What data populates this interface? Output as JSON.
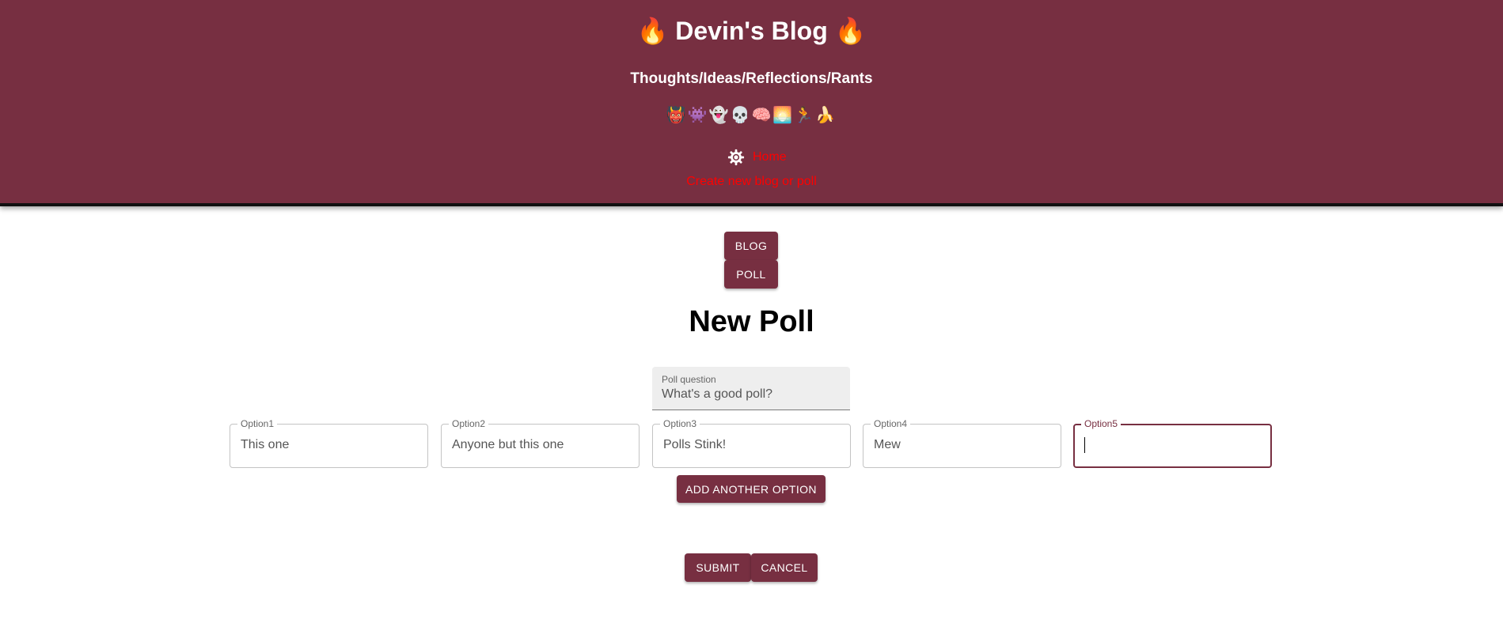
{
  "header": {
    "title": "🔥 Devin's Blog 🔥",
    "tagline": "Thoughts/Ideas/Reflections/Rants",
    "emojis": "👹👾👻💀🧠🌅🏃🍌",
    "home_label": "Home",
    "create_label": "Create new blog or poll"
  },
  "toggle": {
    "blog_label": "BLOG",
    "poll_label": "POLL"
  },
  "main": {
    "title": "New Poll",
    "question": {
      "label": "Poll question",
      "value": "What's a good poll?"
    },
    "options": [
      {
        "label": "Option1",
        "value": "This one"
      },
      {
        "label": "Option2",
        "value": "Anyone but this one"
      },
      {
        "label": "Option3",
        "value": "Polls Stink!"
      },
      {
        "label": "Option4",
        "value": "Mew"
      },
      {
        "label": "Option5",
        "value": ""
      }
    ],
    "add_option_label": "ADD ANOTHER OPTION",
    "submit_label": "SUBMIT",
    "cancel_label": "CANCEL"
  },
  "colors": {
    "brand": "#772f41",
    "link": "#ff0000",
    "header_text": "#ffffff"
  },
  "icons": {
    "theme_toggle": "gear-icon"
  }
}
